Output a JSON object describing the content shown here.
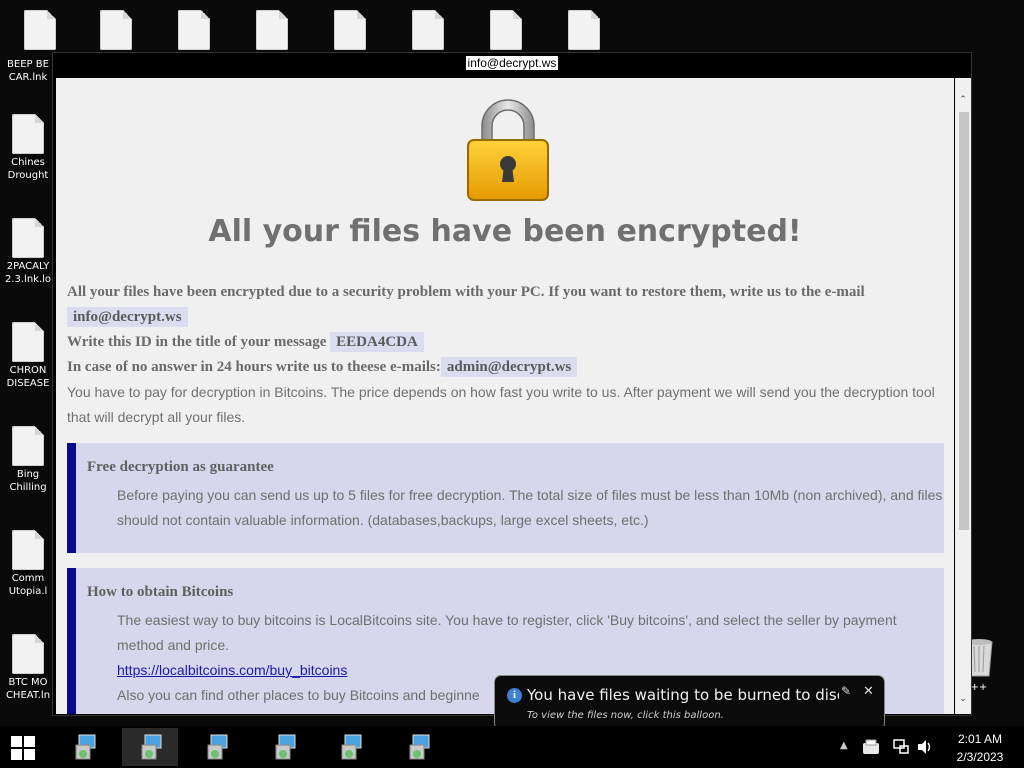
{
  "desktop": {
    "icons": [
      {
        "label_l1": "BEEP BE",
        "label_l2": "CAR.lnk"
      },
      {
        "label_l1": "Chines",
        "label_l2": "Drought"
      },
      {
        "label_l1": "2PACALY",
        "label_l2": "2.3.lnk.lo"
      },
      {
        "label_l1": "CHRON",
        "label_l2": "DISEASE"
      },
      {
        "label_l1": "Bing",
        "label_l2": "Chilling"
      },
      {
        "label_l1": "Comm",
        "label_l2": "Utopia.l"
      },
      {
        "label_l1": "BTC MO",
        "label_l2": "CHEAT.ln"
      }
    ],
    "recycle_label": "n C++"
  },
  "window": {
    "title": "info@decrypt.ws",
    "headline": "All your files have been encrypted!",
    "intro_text": "All your files have been encrypted due to a security problem with your PC. If you want to restore them, write us to the e-mail",
    "email_1": "info@decrypt.ws",
    "id_text": "Write this ID in the title of your message",
    "id_value": "EEDA4CDA",
    "noanswer_text": "In case of no answer in 24 hours write us to theese e-mails:",
    "email_2": "admin@decrypt.ws",
    "payment_text": "You have to pay for decryption in Bitcoins. The price depends on how fast you write to us. After payment we will send you the decryption tool that will decrypt all your files.",
    "box1": {
      "title": "Free decryption as guarantee",
      "text": "Before paying you can send us up to 5 files for free decryption. The total size of files must be less than 10Mb (non archived), and files should not contain valuable information. (databases,backups, large excel sheets, etc.)"
    },
    "box2": {
      "title": "How to obtain Bitcoins",
      "text": "The easiest way to buy bitcoins is LocalBitcoins site. You have to register, click 'Buy bitcoins', and select the seller by payment method and price.",
      "link": "https://localbitcoins.com/buy_bitcoins",
      "text2": "Also you can find other places to buy Bitcoins and beginne"
    }
  },
  "balloon": {
    "title": "You have files waiting to be burned to disc",
    "subtitle": "To view the files now, click this balloon."
  },
  "taskbar": {
    "time": "2:01 AM",
    "date": "2/3/2023"
  }
}
